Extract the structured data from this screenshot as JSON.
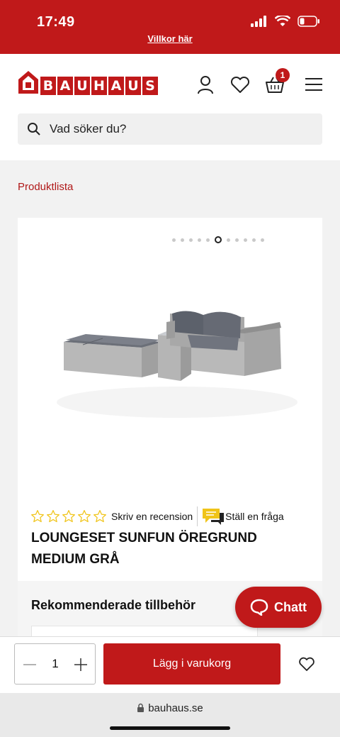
{
  "status": {
    "time": "17:49"
  },
  "promo_text": "Villkor här",
  "header": {
    "logo_text": [
      "B",
      "A",
      "U",
      "H",
      "A",
      "U",
      "S"
    ],
    "cart_count": "1"
  },
  "search": {
    "placeholder": "Vad söker du?"
  },
  "breadcrumb": "Produktlista",
  "gallery": {
    "total_slides": 11,
    "active_slide": 6
  },
  "product": {
    "rating_stars": 0,
    "max_stars": 5,
    "write_review": "Skriv en recension",
    "ask_question": "Ställ en fråga",
    "title": "LOUNGESET SUNFUN ÖREGRUND MEDIUM GRÅ"
  },
  "recommended": {
    "title": "Rekommenderade tillbehör"
  },
  "chat": {
    "label": "Chatt"
  },
  "cart_bar": {
    "quantity": "1",
    "add_label": "Lägg i varukorg"
  },
  "browser": {
    "url": "bauhaus.se"
  },
  "colors": {
    "brand_red": "#c0191a",
    "star_yellow": "#f0c419"
  }
}
